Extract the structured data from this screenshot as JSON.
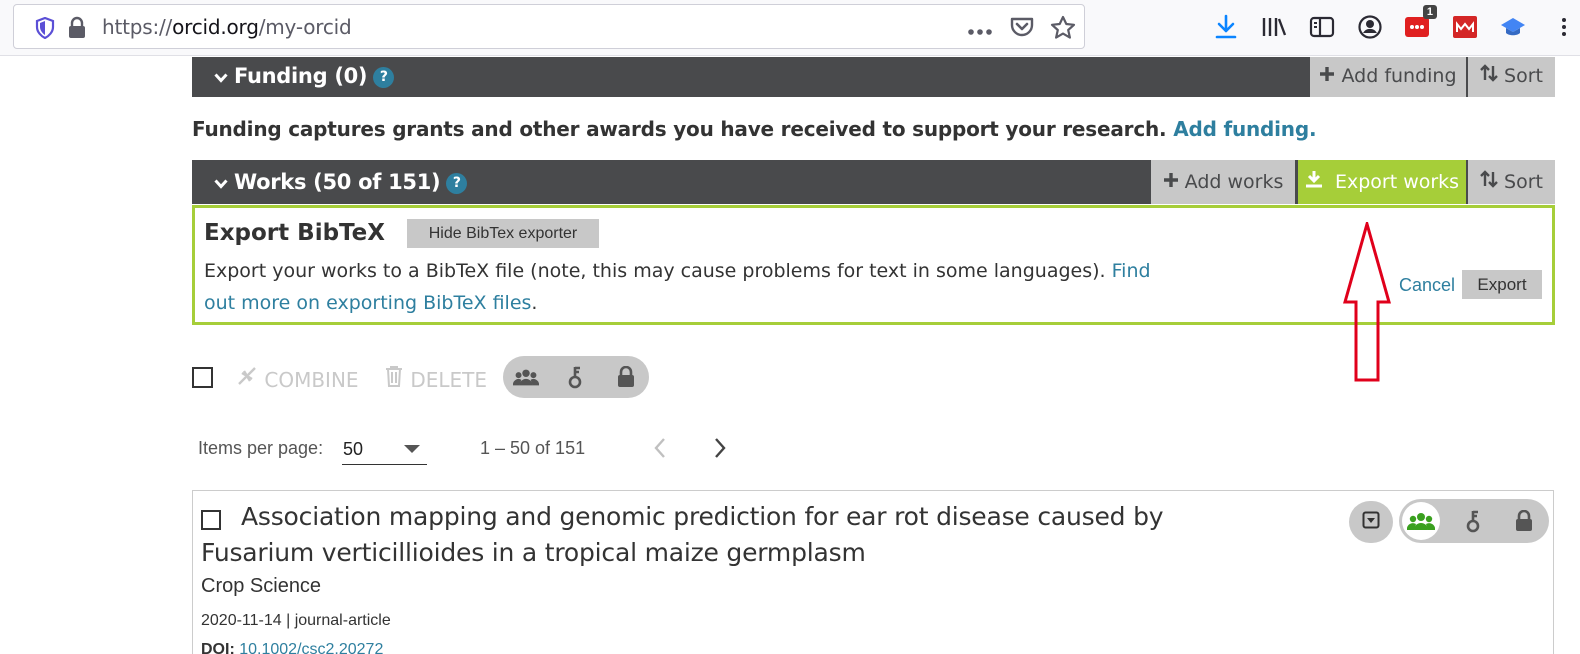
{
  "browser": {
    "url_prefix": "https://",
    "url_host": "orcid.org",
    "url_path": "/my-orcid",
    "extension_badge": "1"
  },
  "funding": {
    "title": "Funding (0)",
    "help_glyph": "?",
    "add_label": "Add funding",
    "sort_label": "Sort",
    "description": "Funding captures grants and other awards you have received to support your research.",
    "description_link": "Add funding."
  },
  "works": {
    "title": "Works (50 of 151)",
    "help_glyph": "?",
    "add_label": "Add works",
    "export_label": "Export works",
    "sort_label": "Sort"
  },
  "export_panel": {
    "title": "Export BibTeX",
    "hide_button": "Hide BibTex exporter",
    "description": "Export your works to a BibTeX file (note, this may cause problems for text in some languages).",
    "link": "Find out more on exporting BibTeX files",
    "link_suffix": ".",
    "cancel": "Cancel",
    "export": "Export"
  },
  "bulk": {
    "combine": "COMBINE",
    "delete": "DELETE"
  },
  "pagination": {
    "items_per_page_label": "Items per page:",
    "items_per_page_value": "50",
    "range": "1 – 50 of 151"
  },
  "work_item": {
    "title": "Association mapping and genomic prediction for ear rot disease caused by Fusarium verticillioides in a tropical maize germplasm",
    "journal": "Crop Science",
    "meta": "2020-11-14 | journal-article",
    "doi_label": "DOI:",
    "doi_value": "10.1002/csc2.20272"
  },
  "colors": {
    "section_bar": "#494a4c",
    "accent_green": "#a6ce39",
    "link_blue": "#2e7f9f",
    "button_gray": "#c8c8c8",
    "annotation_red": "#e0001b"
  }
}
